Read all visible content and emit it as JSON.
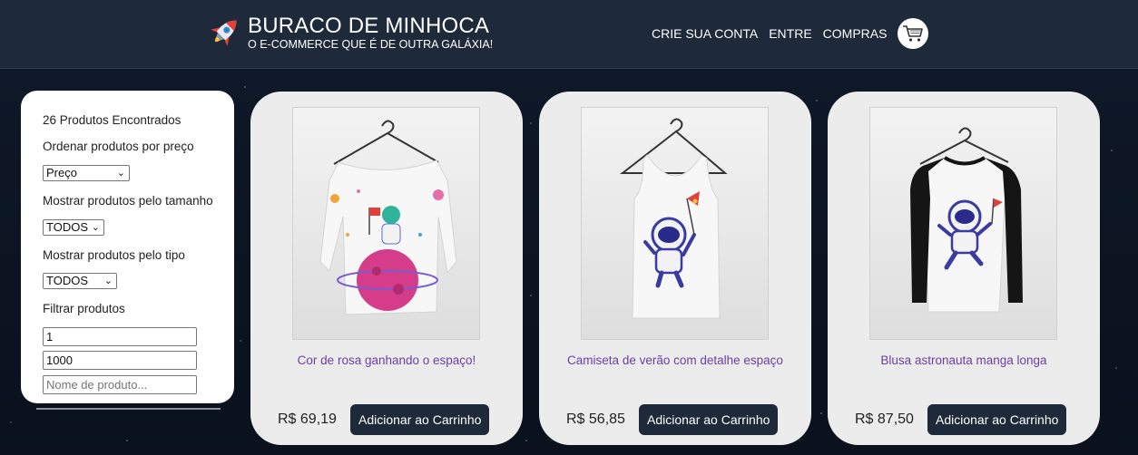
{
  "header": {
    "brand_title": "BURACO DE MINHOCA",
    "brand_subtitle": "O E-COMMERCE QUE É DE OUTRA GALÁXIA!",
    "logo_icon": "rocket-icon",
    "nav": [
      {
        "label": "CRIE SUA CONTA"
      },
      {
        "label": "ENTRE"
      },
      {
        "label": "COMPRAS"
      }
    ],
    "cart_icon": "shopping-cart-icon"
  },
  "filters": {
    "count_text": "26 Produtos Encontrados",
    "order_label": "Ordenar produtos por preço",
    "order_selected": "Preço",
    "size_label": "Mostrar produtos pelo tamanho",
    "size_selected": "TODOS",
    "type_label": "Mostrar produtos pelo tipo",
    "type_selected": "TODOS",
    "filter_label": "Filtrar produtos",
    "min_value": "1",
    "max_value": "1000",
    "name_placeholder": "Nome de produto..."
  },
  "products": [
    {
      "name": "Cor de rosa ganhando o espaço!",
      "price": "R$ 69,19",
      "button": "Adicionar ao Carrinho",
      "image": "long-sleeve-shirt-planet-astronaut"
    },
    {
      "name": "Camiseta de verão com detalhe espaço",
      "price": "R$ 56,85",
      "button": "Adicionar ao Carrinho",
      "image": "tank-top-astronaut"
    },
    {
      "name": "Blusa astronauta manga longa",
      "price": "R$ 87,50",
      "button": "Adicionar ao Carrinho",
      "image": "raglan-shirt-astronaut"
    }
  ],
  "colors": {
    "header_bg": "#1e2a3a",
    "product_name": "#6b3fa0",
    "button_bg": "#1e2a3a",
    "card_bg": "#ececec"
  }
}
